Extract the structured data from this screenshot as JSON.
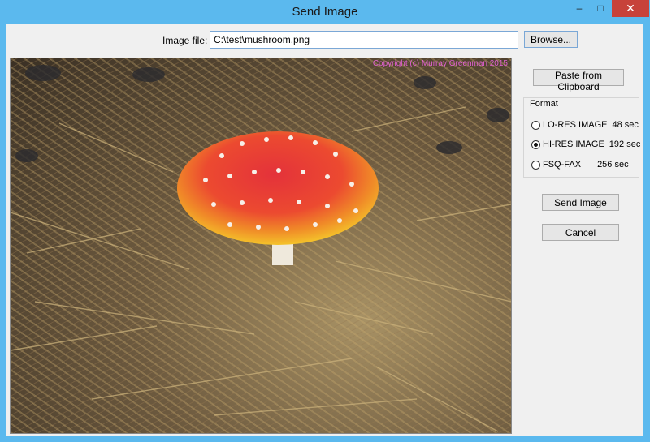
{
  "window": {
    "title": "Send Image",
    "min_icon": "minimize-icon",
    "max_icon": "maximize-icon",
    "close_icon": "close-icon"
  },
  "file": {
    "label": "Image file:",
    "value": "C:\\test\\mushroom.png",
    "browse_label": "Browse..."
  },
  "preview": {
    "copyright": "Copyright (c) Murray Greenman 2015"
  },
  "actions": {
    "paste_label": "Paste from Clipboard",
    "send_label": "Send Image",
    "cancel_label": "Cancel"
  },
  "format": {
    "title": "Format",
    "options": [
      {
        "label": "LO-RES IMAGE",
        "time": "48 sec",
        "selected": false
      },
      {
        "label": "HI-RES IMAGE",
        "time": "192 sec",
        "selected": true
      },
      {
        "label": "FSQ-FAX",
        "time": "256 sec",
        "selected": false
      }
    ]
  },
  "colors": {
    "titlebar": "#5bb9ee",
    "close_button": "#c7423a",
    "copyright_text": "#e060d0"
  }
}
